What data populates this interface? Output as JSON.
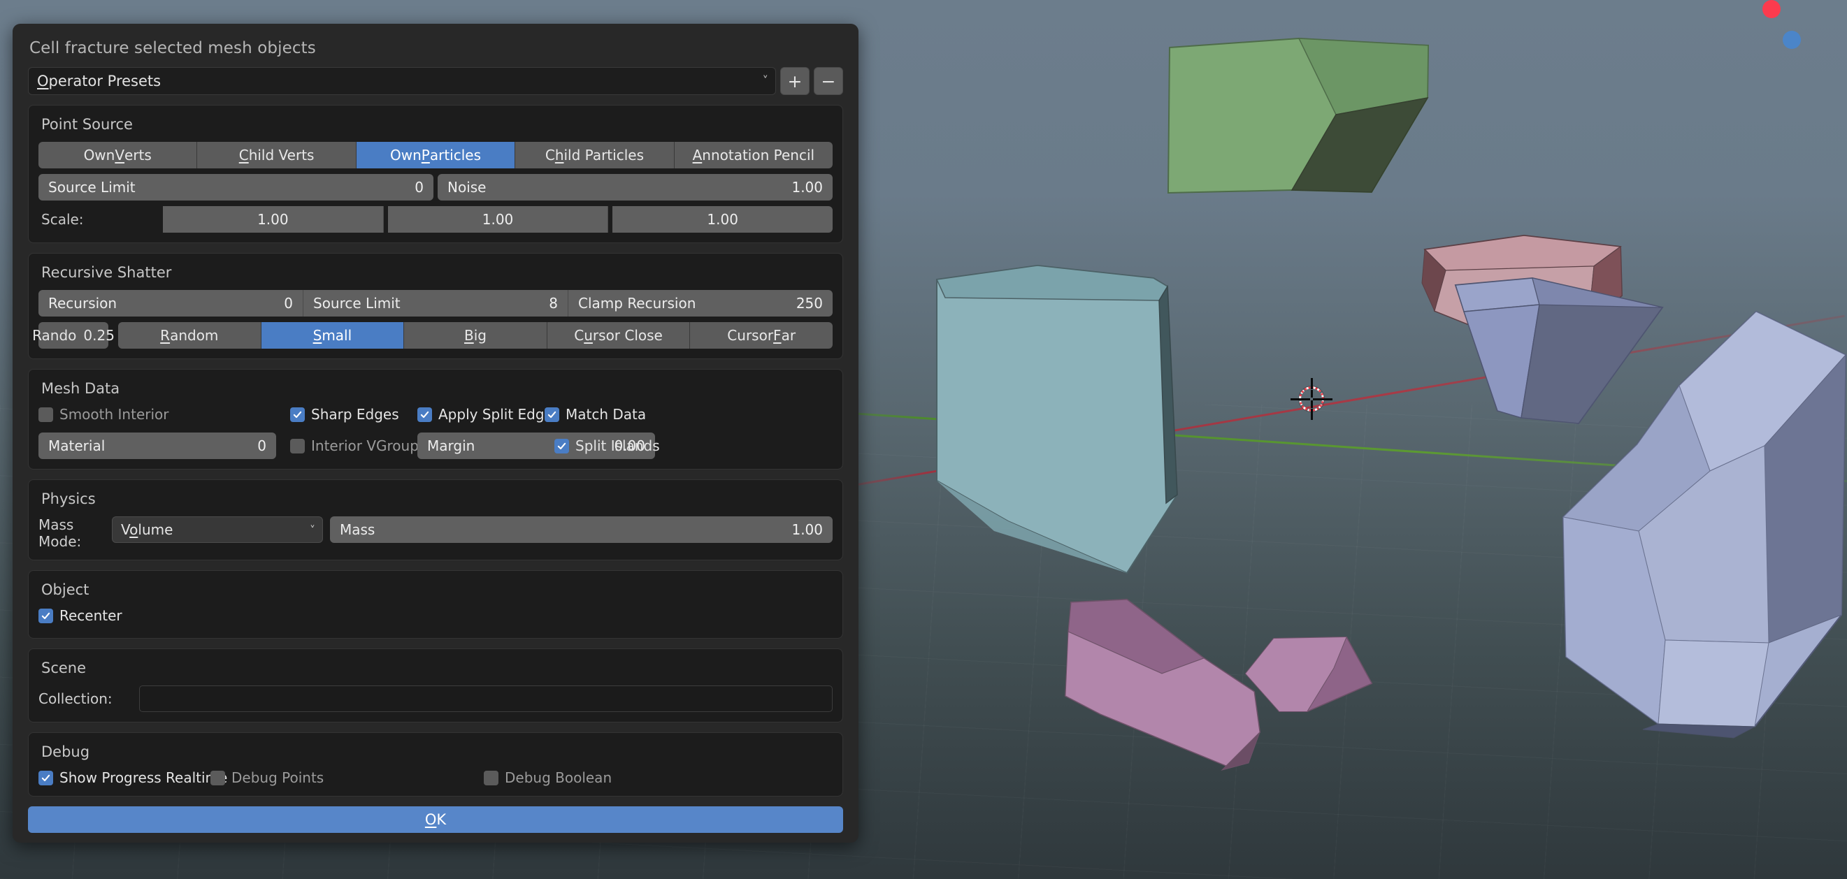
{
  "dialog": {
    "title": "Cell fracture selected mesh objects",
    "preset": {
      "value": "Operator Presets",
      "chevron": "chevron-down-icon",
      "add_label": "+",
      "remove_label": "−"
    },
    "point_source": {
      "title": "Point Source",
      "modes": [
        {
          "label": "Own Verts",
          "active": false
        },
        {
          "label": "Child Verts",
          "active": false
        },
        {
          "label": "Own Particles",
          "active": true
        },
        {
          "label": "Child Particles",
          "active": false
        },
        {
          "label": "Annotation Pencil",
          "active": false
        }
      ],
      "source_limit_label": "Source Limit",
      "source_limit_value": "0",
      "noise_label": "Noise",
      "noise_value": "1.00",
      "scale_label": "Scale:",
      "scale_values": [
        "1.00",
        "1.00",
        "1.00"
      ]
    },
    "recursive_shatter": {
      "title": "Recursive Shatter",
      "recursion_label": "Recursion",
      "recursion_value": "0",
      "source_limit_label": "Source Limit",
      "source_limit_value": "8",
      "clamp_label": "Clamp Recursion",
      "clamp_value": "250",
      "rando_label": "Rando",
      "rando_value": "0.25",
      "modes": [
        {
          "label": "Random",
          "active": false
        },
        {
          "label": "Small",
          "active": true
        },
        {
          "label": "Big",
          "active": false
        },
        {
          "label": "Cursor Close",
          "active": false
        },
        {
          "label": "Cursor Far",
          "active": false
        }
      ]
    },
    "mesh_data": {
      "title": "Mesh Data",
      "smooth_interior": {
        "label": "Smooth Interior",
        "checked": false,
        "dim": true
      },
      "sharp_edges": {
        "label": "Sharp Edges",
        "checked": true,
        "dim": false
      },
      "apply_split_edge": {
        "label": "Apply Split Edge",
        "checked": true,
        "dim": false
      },
      "match_data": {
        "label": "Match Data",
        "checked": true,
        "dim": false
      },
      "material_label": "Material",
      "material_value": "0",
      "interior_vgroup": {
        "label": "Interior VGroup",
        "checked": false,
        "dim": true
      },
      "margin_label": "Margin",
      "margin_value": "0.00",
      "split_islands": {
        "label": "Split Islands",
        "checked": true,
        "dim": false
      }
    },
    "physics": {
      "title": "Physics",
      "mass_mode_label": "Mass Mode:",
      "mass_mode_value": "Volume",
      "mass_label": "Mass",
      "mass_value": "1.00"
    },
    "object": {
      "title": "Object",
      "recenter": {
        "label": "Recenter",
        "checked": true
      }
    },
    "scene": {
      "title": "Scene",
      "collection_label": "Collection:",
      "collection_value": ""
    },
    "debug": {
      "title": "Debug",
      "show_progress": {
        "label": "Show Progress Realtime",
        "checked": true,
        "dim": false
      },
      "debug_points": {
        "label": "Debug Points",
        "checked": false,
        "dim": true
      },
      "debug_boolean": {
        "label": "Debug Boolean",
        "checked": false,
        "dim": true
      }
    },
    "ok_label": "OK"
  },
  "viewport": {
    "cursor_name": "3d-cursor",
    "gizmo": {
      "x_axis": "X",
      "z_axis": "Z"
    },
    "meshes": [
      {
        "name": "green-shard",
        "color": "#7da874"
      },
      {
        "name": "teal-shard",
        "color": "#8cb2ba"
      },
      {
        "name": "red-shard",
        "color": "#c59aa2"
      },
      {
        "name": "blue-cone-shard",
        "color": "#96a0c7"
      },
      {
        "name": "blue-block-shard",
        "color": "#a5afd0"
      },
      {
        "name": "magenta-shard-large",
        "color": "#b286ab"
      },
      {
        "name": "magenta-shard-small",
        "color": "#b286ab"
      }
    ]
  },
  "colors": {
    "accent": "#4a7dc4",
    "panel_bg": "#282828",
    "section_bg": "#1c1c1c",
    "field_bg": "#606060",
    "ok_button": "#5786c9"
  }
}
